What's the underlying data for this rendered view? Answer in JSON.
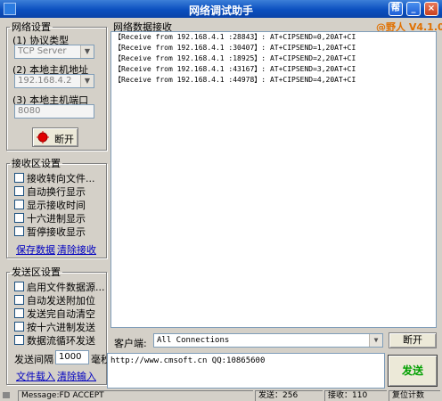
{
  "window": {
    "title": "网络调试助手",
    "help_label": "帮",
    "minimize_label": "_",
    "close_label": "×"
  },
  "network_settings": {
    "title": "网络设置",
    "protocol_label": "(1) 协议类型",
    "protocol_value": "TCP Server",
    "local_ip_label": "(2) 本地主机地址",
    "local_ip_value": "192.168.4.2",
    "local_port_label": "(3) 本地主机端口",
    "local_port_value": "8080",
    "connect_button": "断开"
  },
  "receive_settings": {
    "title": "接收区设置",
    "options": [
      {
        "label": "接收转向文件...",
        "checked": false
      },
      {
        "label": "自动换行显示",
        "checked": false
      },
      {
        "label": "显示接收时间",
        "checked": false
      },
      {
        "label": "十六进制显示",
        "checked": false
      },
      {
        "label": "暂停接收显示",
        "checked": false
      }
    ],
    "save_data_link": "保存数据",
    "clear_receive_link": "清除接收"
  },
  "send_settings": {
    "title": "发送区设置",
    "options": [
      {
        "label": "启用文件数据源...",
        "checked": false
      },
      {
        "label": "自动发送附加位",
        "checked": false
      },
      {
        "label": "发送完自动清空",
        "checked": false
      },
      {
        "label": "按十六进制发送",
        "checked": false
      },
      {
        "label": "数据流循环发送",
        "checked": false
      }
    ],
    "interval_label": "发送间隔",
    "interval_value": "1000",
    "interval_unit": "毫秒",
    "load_file_link": "文件载入",
    "clear_input_link": "清除输入"
  },
  "receive_area": {
    "title": "网络数据接收",
    "version": "@野人 V4.1.0",
    "lines": [
      "【Receive from 192.168.4.1 :28843】: AT+CIPSEND=0,20AT+CI",
      "【Receive from 192.168.4.1 :30407】: AT+CIPSEND=1,20AT+CI",
      "【Receive from 192.168.4.1 :18925】: AT+CIPSEND=2,20AT+CI",
      "【Receive from 192.168.4.1 :43167】: AT+CIPSEND=3,20AT+CI",
      "【Receive from 192.168.4.1 :44978】: AT+CIPSEND=4,20AT+CI"
    ]
  },
  "client_bar": {
    "label": "客户端:",
    "value": "All Connections",
    "disconnect_button": "断开"
  },
  "send_area": {
    "text": "http://www.cmsoft.cn QQ:10865600",
    "send_button": "发送"
  },
  "status_bar": {
    "message": "Message:FD ACCEPT",
    "sent_label": "发送：256",
    "received_label": "接收：110",
    "reset_label": "复位计数"
  },
  "colors": {
    "titlebar": "#0b4fbf",
    "send_button_text": "#00a000",
    "version_text": "#e07000",
    "link": "#0000c0",
    "indicator": "#e00000"
  }
}
